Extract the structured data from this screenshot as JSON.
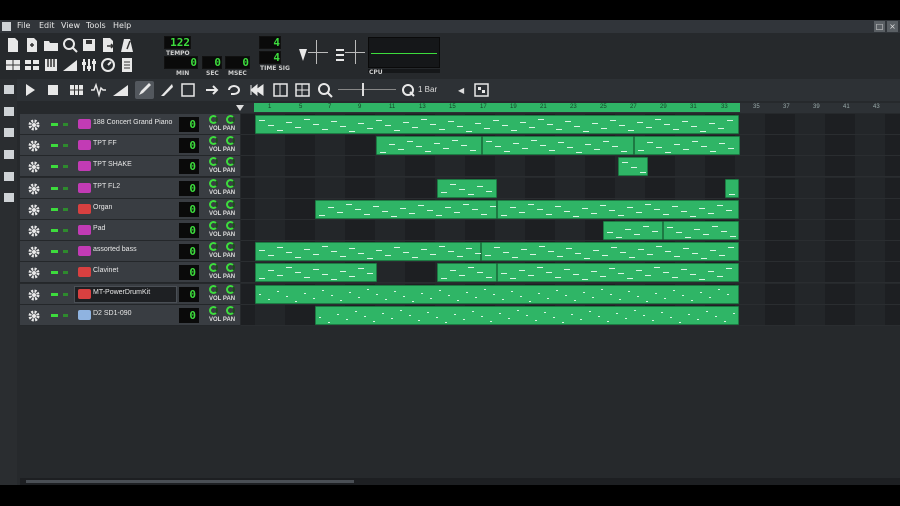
{
  "menu": [
    "File",
    "Edit",
    "View",
    "Tools",
    "Help"
  ],
  "transport": {
    "tempo": "122",
    "tempo_label": "TEMPO",
    "min": "0",
    "min_label": "MIN",
    "sec": "0",
    "sec_label": "SEC",
    "msec": "0",
    "msec_label": "MSEC",
    "timesig_num": "4",
    "timesig_den": "4",
    "timesig_label": "TIME SIG",
    "cpu_label": "CPU"
  },
  "editor": {
    "quantize": "1 Bar"
  },
  "ruler": {
    "bars": [
      "1",
      "5",
      "7",
      "9",
      "11",
      "13",
      "15",
      "17",
      "19",
      "21",
      "23",
      "25",
      "27",
      "29",
      "31",
      "33",
      "35",
      "37",
      "39",
      "41",
      "43"
    ]
  },
  "tracks": [
    {
      "name": "188 Concert Grand Piano",
      "type": "instrument",
      "value": "0",
      "vol": "VOL",
      "pan": "PAN"
    },
    {
      "name": "TPT FF",
      "type": "instrument",
      "value": "0",
      "vol": "VOL",
      "pan": "PAN"
    },
    {
      "name": "TPT SHAKE",
      "type": "instrument",
      "value": "0",
      "vol": "VOL",
      "pan": "PAN"
    },
    {
      "name": "TPT FL2",
      "type": "instrument",
      "value": "0",
      "vol": "VOL",
      "pan": "PAN"
    },
    {
      "name": "Organ",
      "type": "synth",
      "value": "0",
      "vol": "VOL",
      "pan": "PAN"
    },
    {
      "name": "Pad",
      "type": "instrument",
      "value": "0",
      "vol": "VOL",
      "pan": "PAN"
    },
    {
      "name": "assorted bass",
      "type": "instrument",
      "value": "0",
      "vol": "VOL",
      "pan": "PAN"
    },
    {
      "name": "Clavinet",
      "type": "synth",
      "value": "0",
      "vol": "VOL",
      "pan": "PAN"
    },
    {
      "name": "MT-PowerDrumKit",
      "type": "synth",
      "value": "0",
      "vol": "VOL",
      "pan": "PAN"
    },
    {
      "name": "D2 SD1-090",
      "type": "sample",
      "value": "0",
      "vol": "VOL",
      "pan": "PAN"
    }
  ],
  "colors": {
    "accent": "#3ddc3d",
    "clip": "#2fb566",
    "instrument_icon": "#c23bb5"
  }
}
